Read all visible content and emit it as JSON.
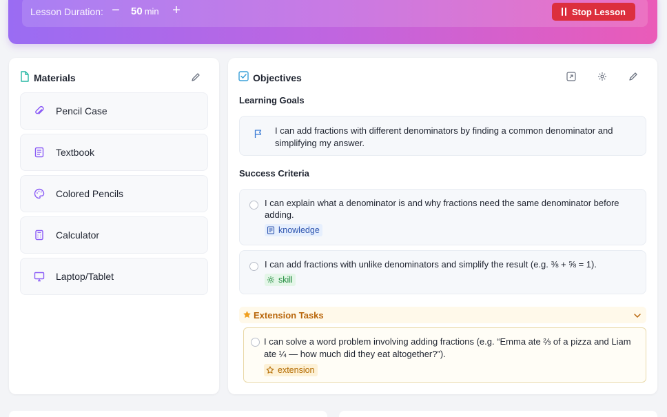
{
  "header": {
    "duration_label": "Lesson Duration:",
    "duration_value": "50",
    "duration_unit": "min",
    "minus_label": "−",
    "plus_label": "+",
    "stop_label": "Stop Lesson"
  },
  "materials": {
    "title": "Materials",
    "items": [
      {
        "label": "Pencil Case",
        "icon": "paperclip-icon"
      },
      {
        "label": "Textbook",
        "icon": "book-icon"
      },
      {
        "label": "Colored Pencils",
        "icon": "palette-icon"
      },
      {
        "label": "Calculator",
        "icon": "calculator-icon"
      },
      {
        "label": "Laptop/Tablet",
        "icon": "monitor-icon"
      }
    ]
  },
  "objectives": {
    "title": "Objectives",
    "learning_goals_label": "Learning Goals",
    "learning_goal": "I can add fractions with different denominators by finding a common denominator and simplifying my answer.",
    "success_criteria_label": "Success Criteria",
    "criteria": [
      {
        "text": "I can explain what a denominator is and why fractions need the same denominator before adding.",
        "tag": "knowledge"
      },
      {
        "text": "I can add fractions with unlike denominators and simplify the result (e.g. ⅜ + ⅝ = 1).",
        "tag": "skill"
      }
    ],
    "extension_label": "Extension Tasks",
    "extension_task": {
      "text": "I can solve a word problem involving adding fractions (e.g. “Emma ate ⅔ of a pizza and Liam ate ¼ — how much did they eat altogether?”).",
      "tag": "extension"
    }
  },
  "colors": {
    "banner_start": "#9a6cf3",
    "banner_end": "#ea5bb8",
    "stop_button": "#dc2f3d",
    "accent_purple": "#8b5cf6",
    "objectives_icon": "#3aa0d8"
  }
}
